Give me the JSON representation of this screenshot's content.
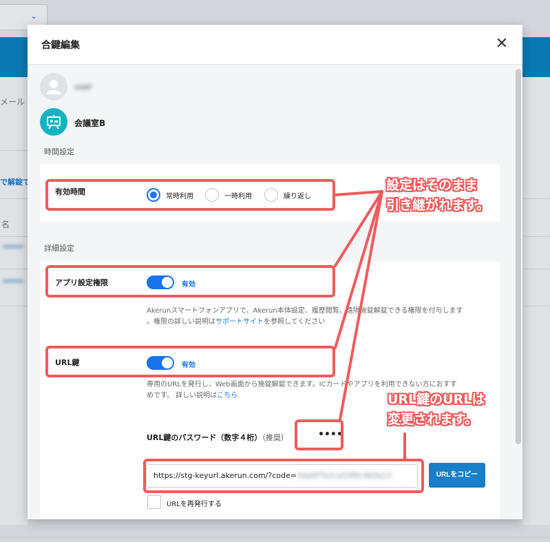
{
  "background": {
    "label_mail": "メール",
    "label_unlock": "で解錠で",
    "label_name": "名"
  },
  "modal": {
    "title": "合鍵編集",
    "close_label": "✕",
    "user_name": "user",
    "room_name": "会議室B",
    "time_section": "時間設定",
    "valid_time_label": "有効時間",
    "radio_options": [
      "常時利用",
      "一時利用",
      "繰り返し"
    ],
    "radio_selected": "常時利用",
    "detail_section": "詳細設定",
    "app_permission_label": "アプリ設定権限",
    "app_permission_status": "有効",
    "app_permission_desc_line1": "Akerunスマートフォンアプリで、Akerun本体設定、履歴閲覧、遠隔施錠解錠できる権限を付与します",
    "app_permission_desc_pre": "。権限の詳しい説明は",
    "app_permission_desc_link": "サポートサイト",
    "app_permission_desc_post": "を参照してください",
    "url_key_label": "URL鍵",
    "url_key_status": "有効",
    "url_key_desc_line1": "専用のURLを発行し、Web画面から施錠解錠できます。ICカードやアプリを利用できない方におすす",
    "url_key_desc_pre": "めです。 詳しい説明は",
    "url_key_desc_link": "こちら",
    "password_label": "URL鍵のパスワード（数字４桁）",
    "password_sub": "（推奨）",
    "password_value": "••••",
    "url_value": "https://stg-keyurl.akerun.com/?code=",
    "url_hidden": "3da0f7b2ca33f0c4b0a13",
    "copy_button": "URLをコピー",
    "reissue_label": "URLを再発行する"
  },
  "annotations": {
    "callout1_line1": "設定はそのまま",
    "callout1_line2": "引き継がれます。",
    "callout2_line1": "URL鍵のURLは",
    "callout2_line2": "変更されます。",
    "color": "#ef5b5b"
  }
}
